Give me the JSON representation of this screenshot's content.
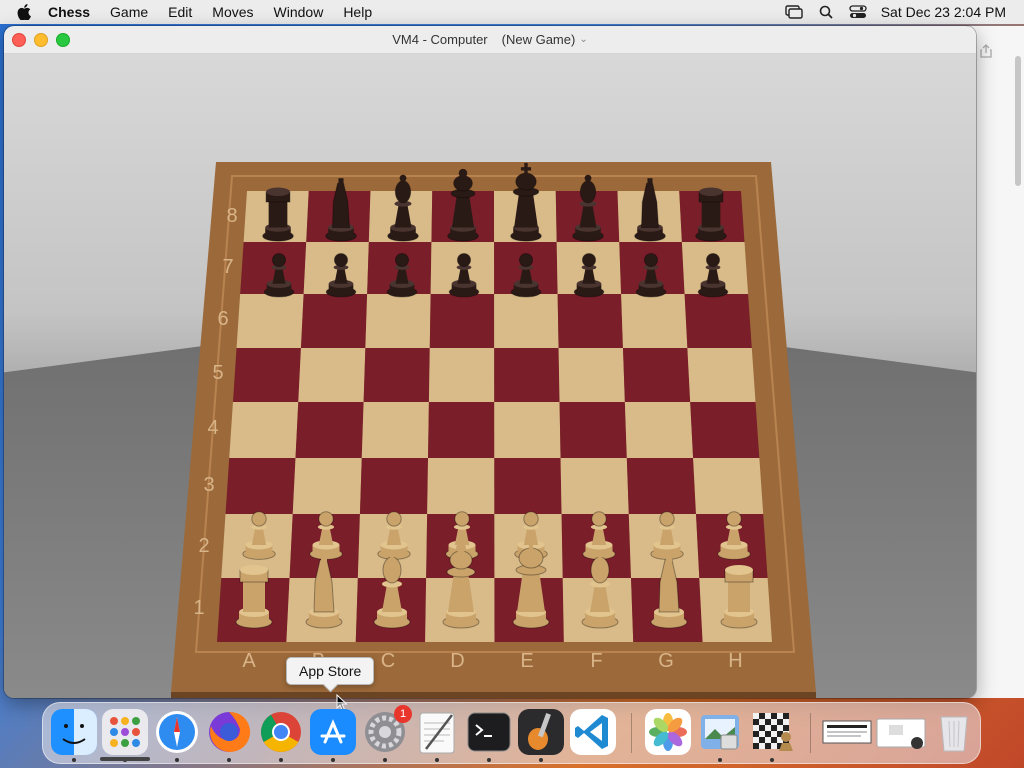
{
  "menubar": {
    "app_name": "Chess",
    "menus": [
      "Game",
      "Edit",
      "Moves",
      "Window",
      "Help"
    ],
    "clock": "Sat Dec 23  2:04 PM"
  },
  "window": {
    "title": "VM4 - Computer",
    "subtitle": "(New Game)"
  },
  "board": {
    "files": [
      "A",
      "B",
      "C",
      "D",
      "E",
      "F",
      "G",
      "H"
    ],
    "ranks": [
      "1",
      "2",
      "3",
      "4",
      "5",
      "6",
      "7",
      "8"
    ],
    "light_square": "#d9bb8a",
    "dark_square": "#7a1e2a",
    "frame_color": "#9c6a3a",
    "white_piece_color": "#c9a36a",
    "black_piece_color": "#2a1a16",
    "pieces": {
      "rank8": [
        "rook",
        "knight",
        "bishop",
        "queen",
        "king",
        "bishop",
        "knight",
        "rook"
      ],
      "rank7": [
        "pawn",
        "pawn",
        "pawn",
        "pawn",
        "pawn",
        "pawn",
        "pawn",
        "pawn"
      ],
      "rank2": [
        "pawn",
        "pawn",
        "pawn",
        "pawn",
        "pawn",
        "pawn",
        "pawn",
        "pawn"
      ],
      "rank1": [
        "rook",
        "knight",
        "bishop",
        "queen",
        "king",
        "bishop",
        "knight",
        "rook"
      ]
    }
  },
  "tooltip": {
    "text": "App Store"
  },
  "dock": {
    "apps": [
      {
        "name": "Finder",
        "icon": "finder-icon"
      },
      {
        "name": "Launchpad",
        "icon": "launchpad-icon"
      },
      {
        "name": "Safari",
        "icon": "safari-icon"
      },
      {
        "name": "Firefox",
        "icon": "firefox-icon"
      },
      {
        "name": "Chrome",
        "icon": "chrome-icon"
      },
      {
        "name": "App Store",
        "icon": "app-store-icon"
      },
      {
        "name": "System Settings",
        "icon": "system-settings-icon",
        "badge": "1"
      },
      {
        "name": "TextEdit",
        "icon": "textedit-icon"
      },
      {
        "name": "Terminal",
        "icon": "terminal-icon"
      },
      {
        "name": "GarageBand",
        "icon": "garageband-icon"
      },
      {
        "name": "Visual Studio Code",
        "icon": "vscode-icon"
      },
      {
        "name": "Photos",
        "icon": "photos-icon"
      },
      {
        "name": "Preview",
        "icon": "preview-icon"
      },
      {
        "name": "Chess",
        "icon": "chess-icon"
      },
      {
        "name": "Document",
        "icon": "document-icon"
      },
      {
        "name": "Folder",
        "icon": "folder-icon"
      },
      {
        "name": "Trash",
        "icon": "trash-icon"
      }
    ],
    "badge_color": "#e8362d"
  }
}
